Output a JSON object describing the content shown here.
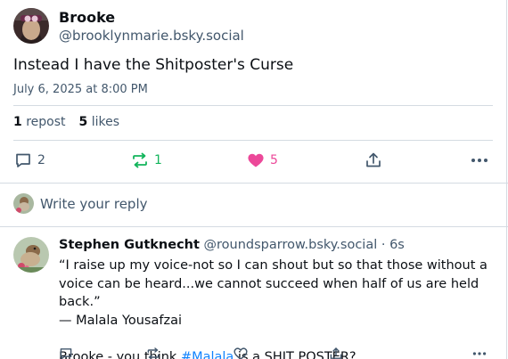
{
  "post": {
    "author_name": "Brooke",
    "author_handle": "@brooklynmarie.bsky.social",
    "text": "Instead I have the Shitposter's Curse",
    "timestamp": "July 6, 2025 at 8:00 PM",
    "reposts_count": "1",
    "reposts_label": "repost",
    "likes_count": "5",
    "likes_label": "likes",
    "actions": {
      "reply_count": "2",
      "repost_count": "1",
      "like_count": "5"
    }
  },
  "reply_composer": {
    "placeholder": "Write your reply"
  },
  "reply": {
    "author_name": "Stephen Gutknecht",
    "author_handle": "@roundsparrow.bsky.social",
    "separator": "·",
    "age": "6s",
    "line1": "“I raise up my voice-not so I can shout but so that those without a voice can be heard...we cannot succeed when half of us are held back.”",
    "line2": "— Malala Yousafzai",
    "line3_pre": "Brooke - you think ",
    "hashtag": "#Malala",
    "line3_post": " is a SHIT POSTER?"
  },
  "colors": {
    "text": "#0b0f14",
    "muted": "#42576c",
    "repost_green": "#13b55c",
    "like_pink": "#ec4899",
    "link_blue": "#1083fe",
    "border": "#d4dbe2"
  }
}
